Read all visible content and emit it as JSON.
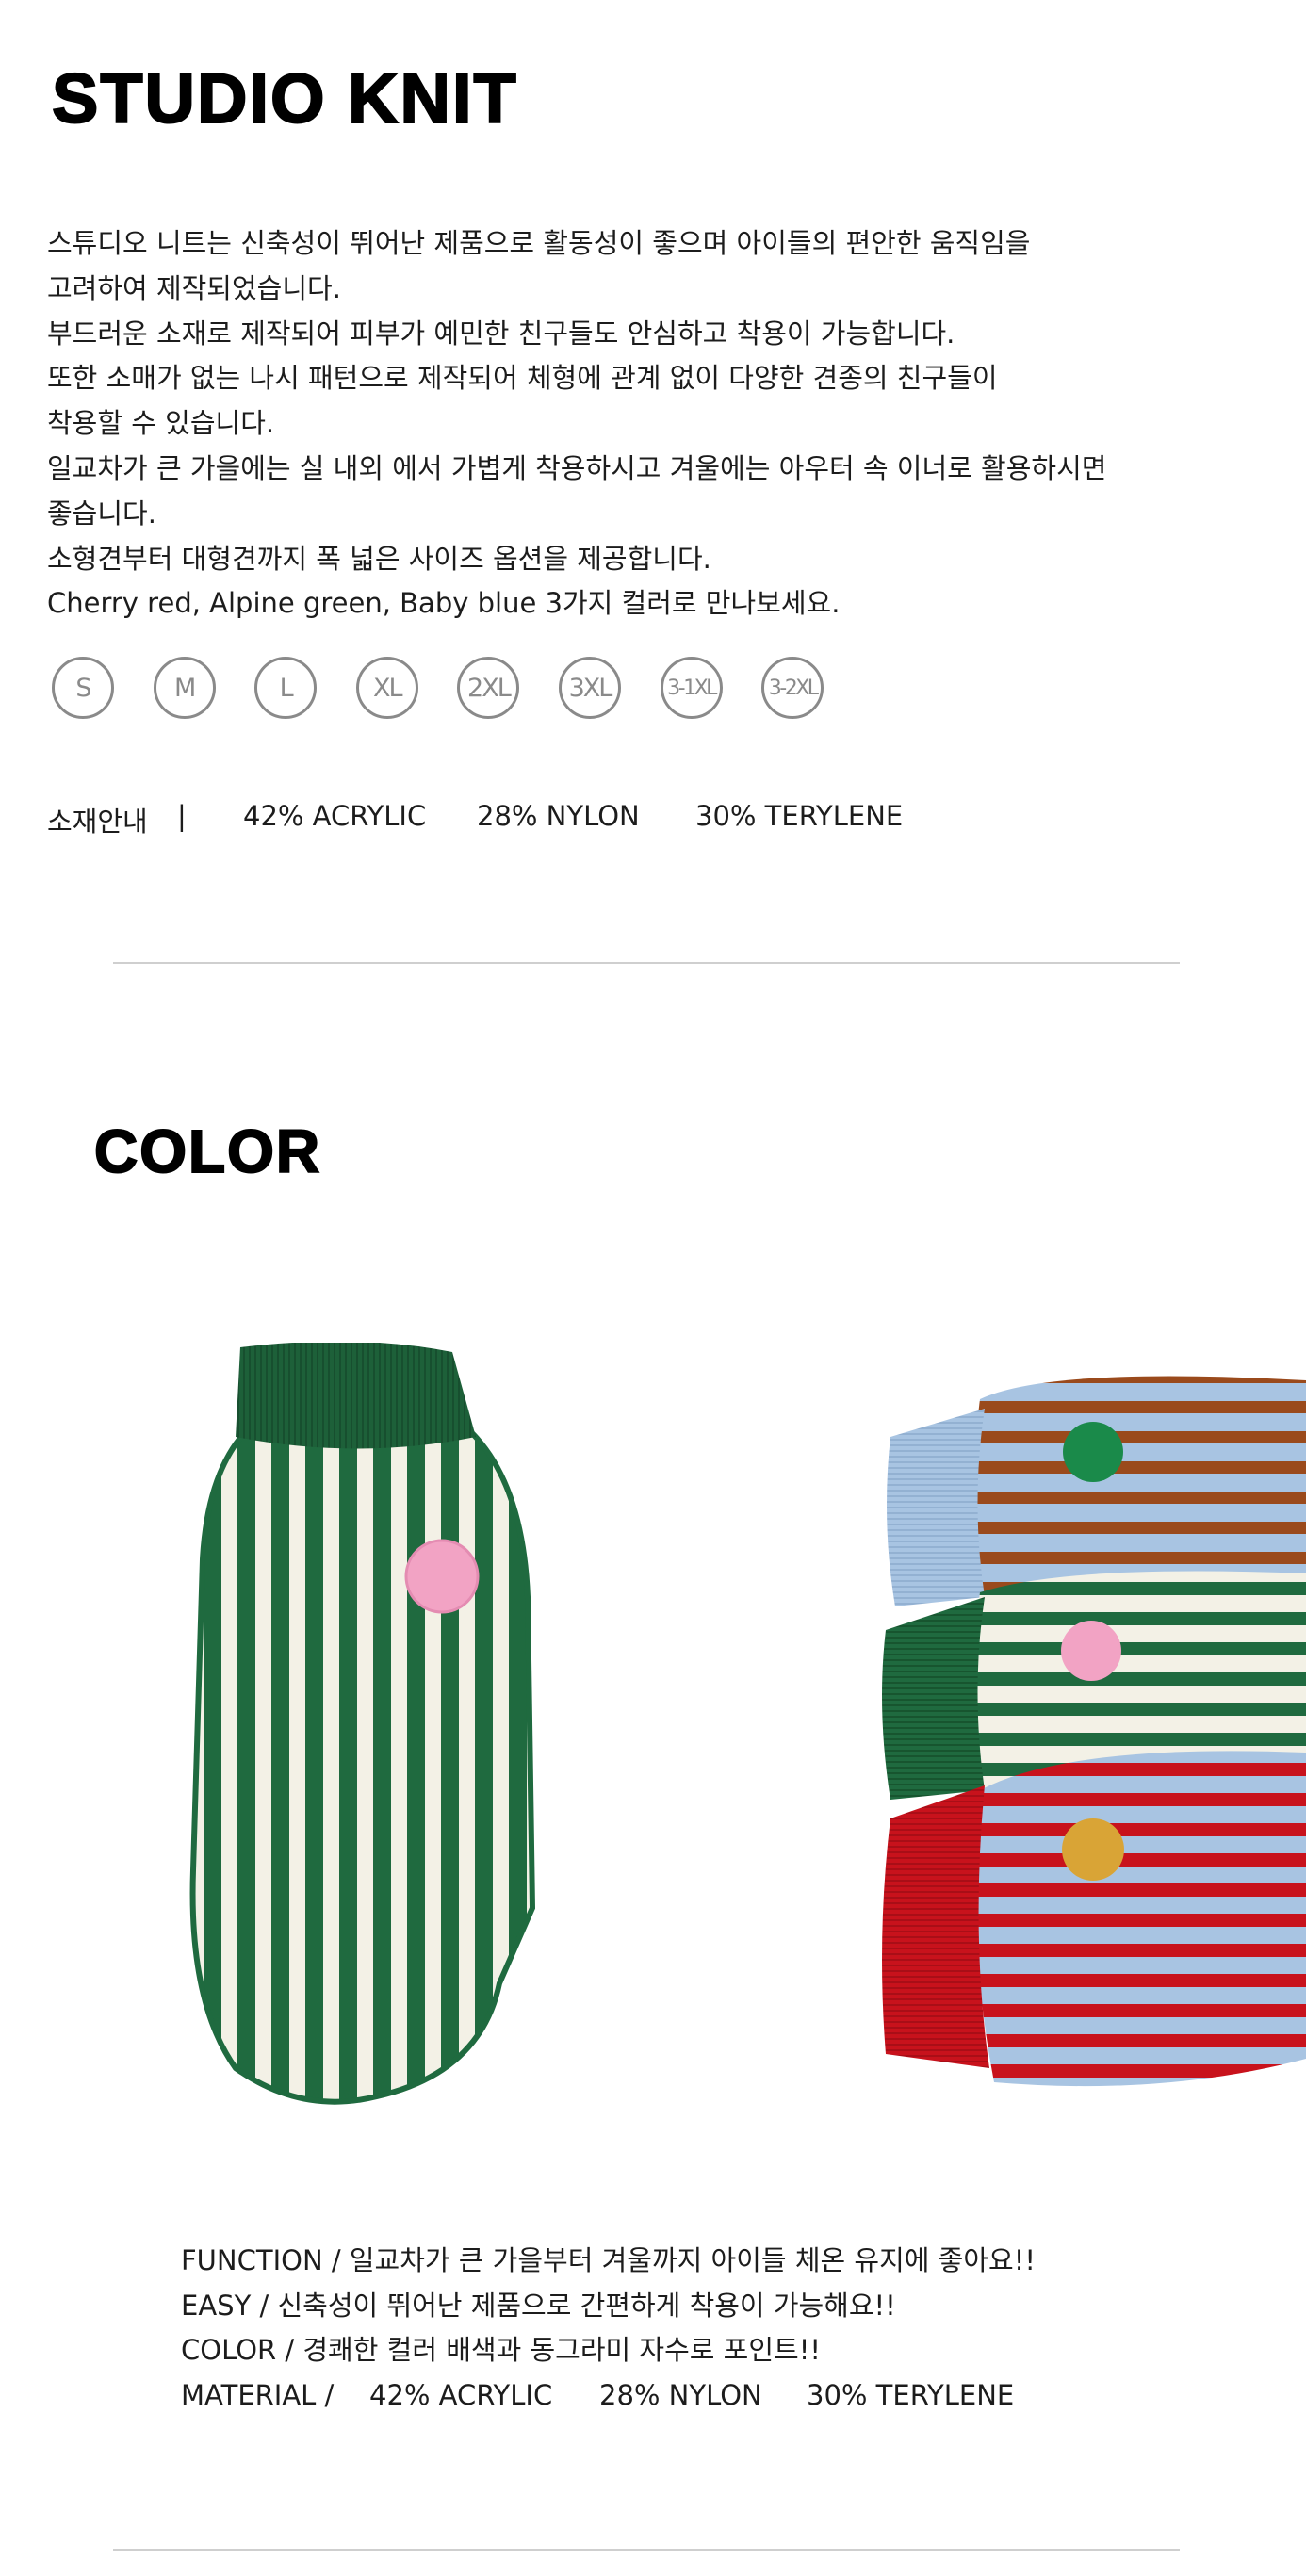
{
  "header": {
    "title": "STUDIO KNIT"
  },
  "description": [
    "스튜디오 니트는 신축성이 뛰어난 제품으로 활동성이 좋으며 아이들의 편안한 움직임을",
    "고려하여 제작되었습니다.",
    "부드러운 소재로 제작되어 피부가 예민한 친구들도 안심하고 착용이 가능합니다.",
    "또한 소매가 없는 나시 패턴으로 제작되어 체형에 관계 없이 다양한 견종의 친구들이",
    "착용할 수 있습니다.",
    "일교차가 큰 가을에는 실 내외 에서 가볍게 착용하시고 겨울에는 아우터 속 이너로 활용하시면",
    "좋습니다.",
    "소형견부터 대형견까지 폭 넓은 사이즈 옵션을 제공합니다.",
    "Cherry red, Alpine green, Baby blue  3가지 컬러로 만나보세요."
  ],
  "sizes": [
    "S",
    "M",
    "L",
    "XL",
    "2XL",
    "3XL",
    "3-1XL",
    "3-2XL"
  ],
  "material": {
    "label": "소재안내",
    "separator": "|",
    "acrylic": "42% ACRYLIC",
    "nylon": "28% NYLON",
    "terylene": "30% TERYLENE"
  },
  "color_section": {
    "title": "COLOR"
  },
  "features": {
    "function": "FUNCTION / 일교차가 큰 가을부터 겨울까지 아이들 체온 유지에 좋아요!!",
    "easy": "EASY / 신축성이 뛰어난 제품으로 간편하게 착용이 가능해요!!",
    "color": "COLOR / 경쾌한 컬러 배색과 동그라미 자수로 포인트!!",
    "material_label": "MATERIAL /",
    "acrylic": "42% ACRYLIC",
    "nylon": "28% NYLON",
    "terylene": "30% TERYLENE"
  },
  "colors": {
    "alpine_green": "#1f6a3f",
    "cream": "#f3f1e6",
    "pink_dot": "#f2a3c4",
    "baby_blue": "#a8c4e2",
    "brown_stripe": "#9a4a1c",
    "cherry_red": "#c8121c",
    "mustard_dot": "#d9a436",
    "green_dot": "#1a8a4a"
  }
}
